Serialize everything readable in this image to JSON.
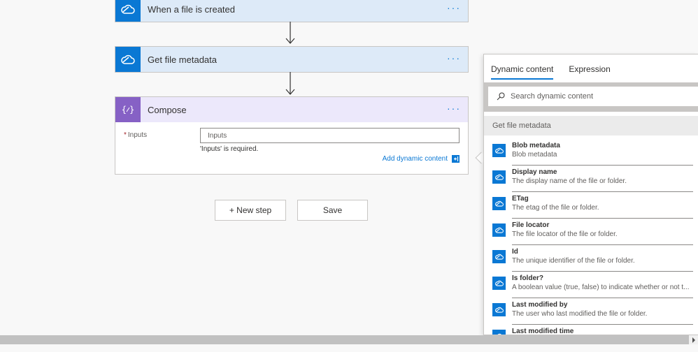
{
  "colors": {
    "accent": "#0a78d4",
    "compose": "#8661c5",
    "trigger_header_bg": "#ddeaf8",
    "compose_header_bg": "#ece8fb"
  },
  "flow": {
    "trigger": {
      "title": "When a file is created",
      "icon": "cloud-icon",
      "more": "···"
    },
    "metadata": {
      "title": "Get file metadata",
      "icon": "cloud-icon",
      "more": "···"
    },
    "compose": {
      "title": "Compose",
      "icon": "compose-braces-icon",
      "more": "···",
      "inputs_required_mark": "*",
      "inputs_label": "Inputs",
      "inputs_placeholder": "Inputs",
      "inputs_error": "'Inputs' is required.",
      "add_dynamic": "Add dynamic content"
    },
    "new_step": "+ New step",
    "save": "Save"
  },
  "panel": {
    "tabs": [
      {
        "label": "Dynamic content",
        "active": true
      },
      {
        "label": "Expression",
        "active": false
      }
    ],
    "search_placeholder": "Search dynamic content",
    "group": "Get file metadata",
    "items": [
      {
        "title": "Blob metadata",
        "desc": "Blob metadata"
      },
      {
        "title": "Display name",
        "desc": "The display name of the file or folder."
      },
      {
        "title": "ETag",
        "desc": "The etag of the file or folder."
      },
      {
        "title": "File locator",
        "desc": "The file locator of the file or folder."
      },
      {
        "title": "Id",
        "desc": "The unique identifier of the file or folder."
      },
      {
        "title": "Is folder?",
        "desc": "A boolean value (true, false) to indicate whether or not t..."
      },
      {
        "title": "Last modified by",
        "desc": "The user who last modified the file or folder."
      },
      {
        "title": "Last modified time",
        "desc": ""
      }
    ]
  }
}
